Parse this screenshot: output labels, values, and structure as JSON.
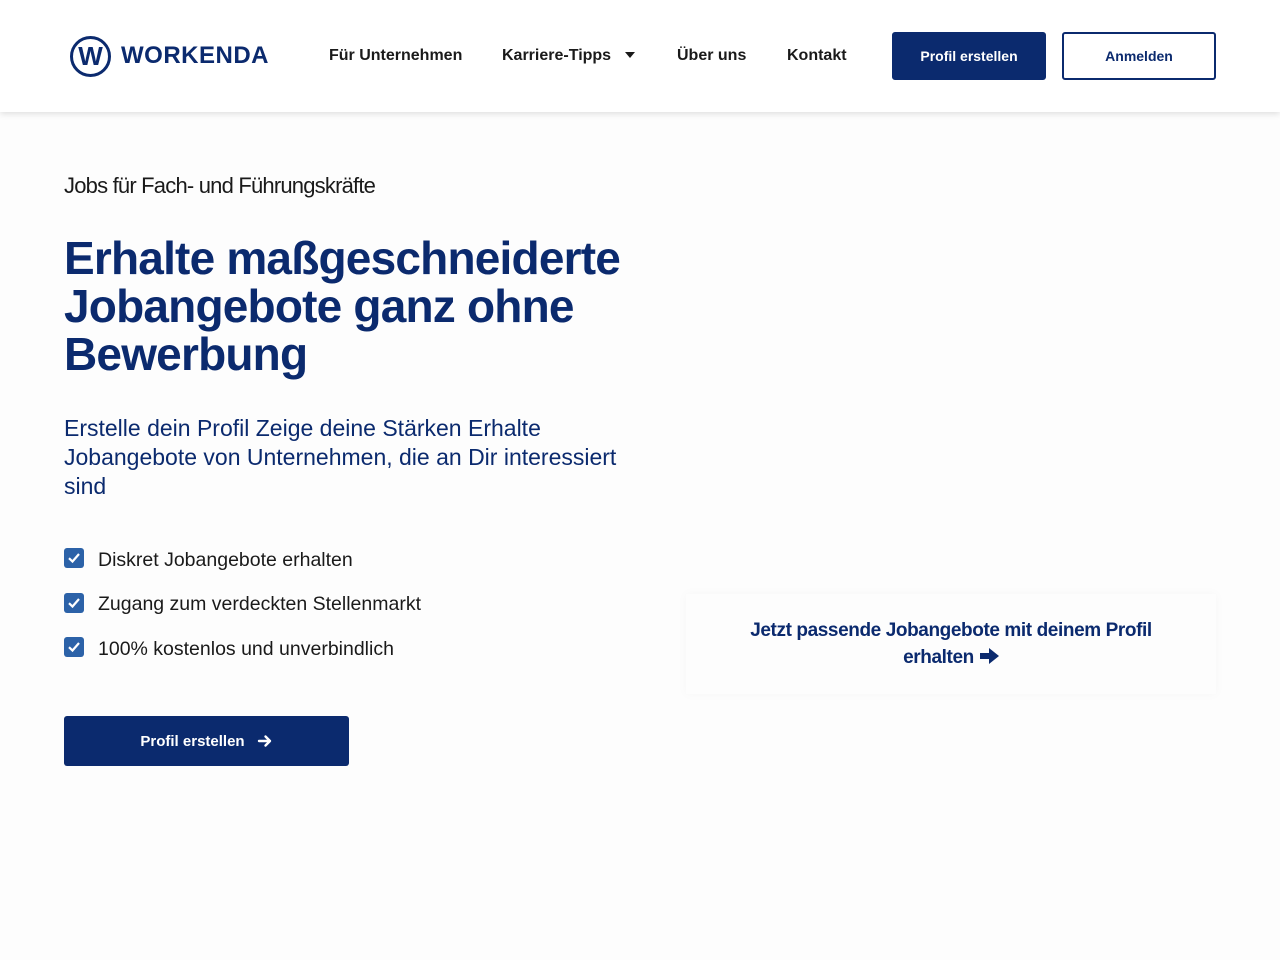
{
  "brand": {
    "logo_letter": "W",
    "logo_text": "WORKENDA",
    "color_primary": "#0b2a6e",
    "color_check": "#2c62a8"
  },
  "nav": {
    "items": [
      {
        "label": "Für Unternehmen"
      },
      {
        "label": "Karriere-Tipps",
        "has_dropdown": true
      },
      {
        "label": "Über uns"
      },
      {
        "label": "Kontakt"
      }
    ],
    "profile_button": "Profil erstellen",
    "login_button": "Anmelden"
  },
  "hero": {
    "eyebrow": "Jobs für Fach- und Führungskräfte",
    "title": "Erhalte maßgeschneiderte Jobangebote ganz ohne Bewerbung",
    "subtitle": "Erstelle dein Profil  Zeige deine Stärken  Erhalte Jobangebote von Unternehmen, die an Dir interessiert sind",
    "benefits": [
      "Diskret Jobangebote erhalten",
      "Zugang zum verdeckten Stellenmarkt",
      "100% kostenlos und unverbindlich"
    ],
    "cta_label": "Profil erstellen",
    "cta_icon": "arrow-right-icon"
  },
  "promo": {
    "text": "Jetzt passende Jobangebote mit deinem Profil erhalten",
    "icon": "arrow-right-icon"
  }
}
